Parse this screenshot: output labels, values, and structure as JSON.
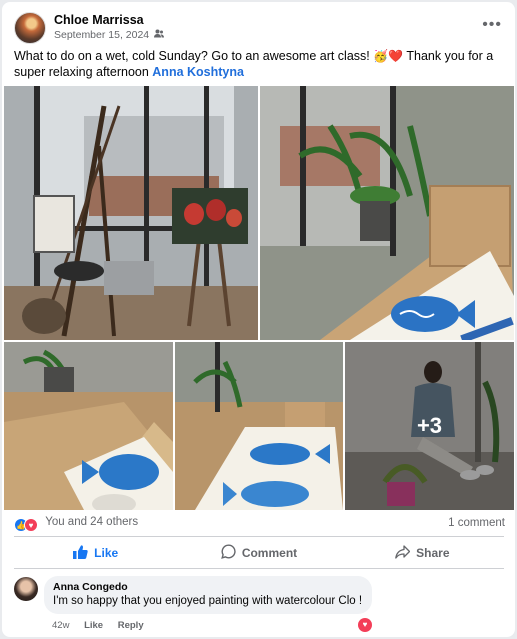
{
  "post": {
    "author": "Chloe Marrissa",
    "date": "September 15, 2024",
    "audience_icon": "friends-icon",
    "caption_text": "What to do on a wet, cold Sunday? Go to an awesome art class! ",
    "caption_emojis": "🥳❤️",
    "caption_text2": " Thank you for a super relaxing afternoon ",
    "mention": "Anna Koshtyna",
    "more_photos_label": "+3"
  },
  "reactions": {
    "summary": "You and 24 others",
    "comments_count": "1 comment"
  },
  "actions": {
    "like": "Like",
    "comment": "Comment",
    "share": "Share"
  },
  "comment": {
    "author": "Anna Congedo",
    "text": "I'm so happy that you enjoyed painting with watercolour Clo !",
    "age": "42w",
    "like": "Like",
    "reply": "Reply"
  },
  "colors": {
    "accent": "#1877f2",
    "love": "#f33e58",
    "mention": "#216fdb"
  }
}
